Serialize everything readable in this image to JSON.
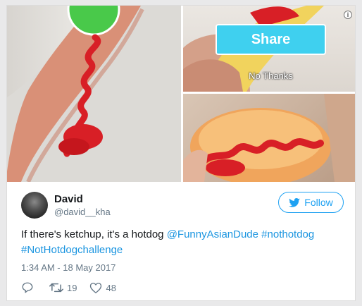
{
  "media": {
    "share_label": "Share",
    "no_thanks_label": "No Thanks",
    "info_icon_glyph": "i"
  },
  "tweet": {
    "display_name": "David",
    "handle": "@david__kha",
    "follow_label": "Follow",
    "text_plain": "If there's ketchup, it's a hotdog ",
    "mention": "@FunnyAsianDude",
    "hashtag_1": "#nothotdog",
    "hashtag_2": "#NotHotdogchallenge",
    "timestamp": "1:34 AM - 18 May 2017",
    "retweet_count": "19",
    "like_count": "48"
  },
  "colors": {
    "twitter_blue": "#1da1f2",
    "link_blue": "#1b95e0",
    "share_cyan": "#3fd0ef",
    "ketchup_red": "#d81f26"
  },
  "icons": {
    "reply": "reply-icon",
    "retweet": "retweet-icon",
    "like": "heart-icon",
    "follow_bird": "twitter-bird-icon",
    "info": "info-icon"
  }
}
